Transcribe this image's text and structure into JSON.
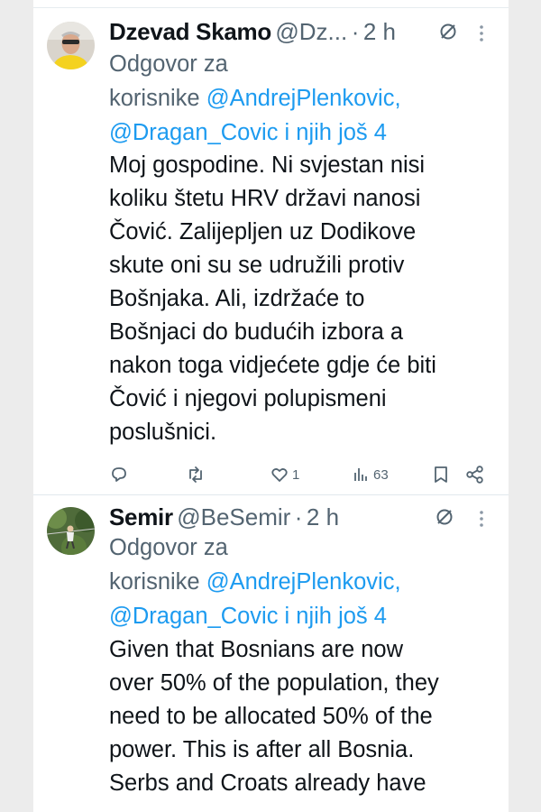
{
  "tweets": [
    {
      "name": "Dzevad Skamo",
      "handle": "@Dz...",
      "separator": "·",
      "time": "2 h",
      "reply_prefix": "Odgovor za",
      "reply_line2_prefix": "korisnike",
      "mention_1": "@AndrejPlenkovic,",
      "mention_2": "@Dragan_Covic i njih još 4",
      "body_lines": [
        "Moj gospodine. Ni svjestan nisi",
        "koliku štetu HRV državi nanosi",
        "Čović. Zalijepljen uz Dodikove",
        "skute oni su se udružili protiv",
        "Bošnjaka. Ali, izdržaće to",
        "Bošnjaci do budućih izbora a",
        "nakon toga vidjećete gdje će biti",
        "Čović i njegovi polupismeni",
        "poslušnici."
      ],
      "likes": "1",
      "views": "63",
      "icons": [
        "reply-icon",
        "retweet-icon",
        "like-icon",
        "views-icon",
        "bookmark-icon",
        "share-icon"
      ]
    },
    {
      "name": "Semir",
      "handle": "@BeSemir",
      "separator": "·",
      "time": "2 h",
      "reply_prefix": "Odgovor za",
      "reply_line2_prefix": "korisnike",
      "mention_1": "@AndrejPlenkovic,",
      "mention_2": "@Dragan_Covic i njih još 4",
      "body_lines": [
        "Given that Bosnians are now",
        "over 50% of the population, they",
        "need to be allocated 50% of the",
        "power.  This is after all Bosnia.",
        "Serbs and Croats already have"
      ]
    }
  ],
  "colors": {
    "accent": "#1d9bf0",
    "muted": "#536471",
    "text": "#0f1419"
  }
}
